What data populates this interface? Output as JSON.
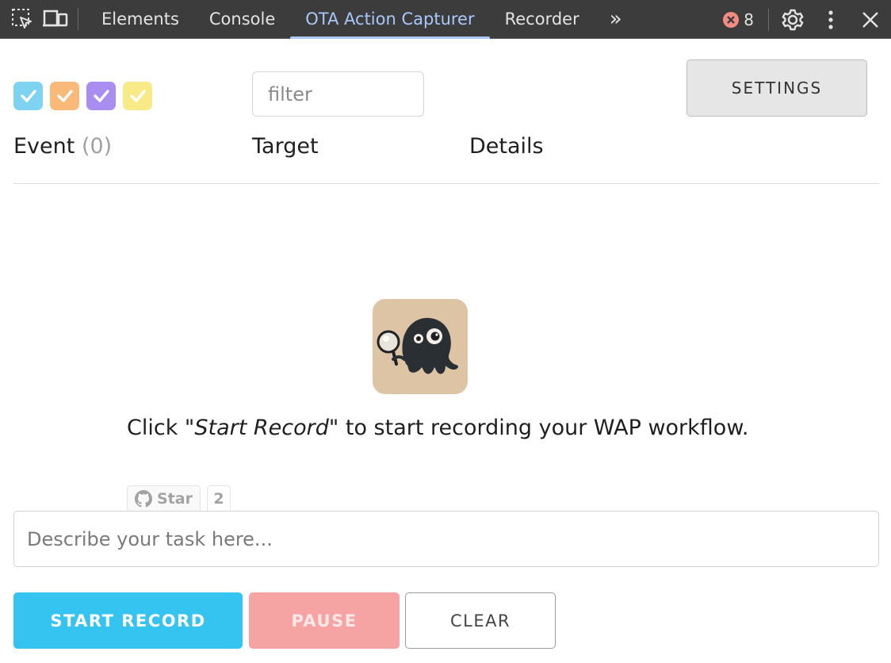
{
  "devtools": {
    "tabs": [
      {
        "label": "Elements"
      },
      {
        "label": "Console"
      },
      {
        "label": "OTA Action Capturer"
      },
      {
        "label": "Recorder"
      }
    ],
    "active_tab": "OTA Action Capturer",
    "more_tabs_glyph": "»",
    "error_count": "8",
    "icons": [
      "inspect-element-icon",
      "device-toggle-icon",
      "more-tabs-icon",
      "error-icon",
      "settings-gear-icon",
      "more-vert-icon",
      "close-icon"
    ]
  },
  "filters": {
    "checkboxes": [
      {
        "name": "filter-blue",
        "color": "#7dd3f0",
        "checked": true
      },
      {
        "name": "filter-orange",
        "color": "#f9b978",
        "checked": true
      },
      {
        "name": "filter-purple",
        "color": "#a98df0",
        "checked": true
      },
      {
        "name": "filter-yellow",
        "color": "#f8ea86",
        "checked": true
      }
    ],
    "filter_placeholder": "filter"
  },
  "settings_label": "SETTINGS",
  "columns": {
    "event": "Event",
    "event_count": "(0)",
    "target": "Target",
    "details": "Details"
  },
  "empty_state": {
    "hint_prefix": "Click ",
    "hint_emphasis": "\"Start Record\"",
    "hint_suffix": " to start recording your WAP workflow."
  },
  "github": {
    "star_label": "Star",
    "star_count": "2"
  },
  "task_placeholder": "Describe your task here...",
  "buttons": {
    "start": "START RECORD",
    "pause": "PAUSE",
    "clear": "CLEAR"
  },
  "colors": {
    "accent_tab": "#a8c7fa",
    "start_button": "#35c3ef",
    "pause_button": "#f6a3a3",
    "devtools_bg": "#3c3c3c"
  }
}
